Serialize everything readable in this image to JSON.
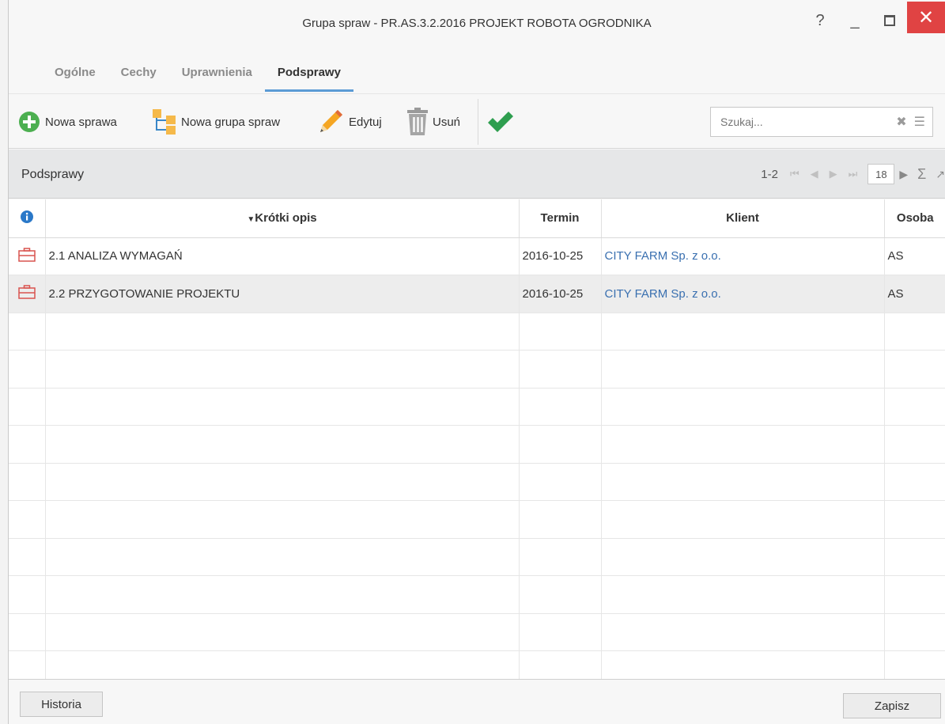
{
  "window": {
    "title": "Grupa spraw - PR.AS.3.2.2016 PROJEKT ROBOTA OGRODNIKA",
    "help_glyph": "?",
    "minimize_glyph": "_",
    "maximize_glyph": "□",
    "close_glyph": "✕"
  },
  "tabs": [
    {
      "label": "Ogólne"
    },
    {
      "label": "Cechy"
    },
    {
      "label": "Uprawnienia"
    },
    {
      "label": "Podsprawy"
    }
  ],
  "toolbar": {
    "new_case": "Nowa sprawa",
    "new_group": "Nowa grupa spraw",
    "edit": "Edytuj",
    "delete": "Usuń",
    "search_placeholder": "Szukaj..."
  },
  "panel": {
    "title": "Podsprawy",
    "range": "1-2",
    "page_size": "18"
  },
  "columns": {
    "description": "Krótki opis",
    "term": "Termin",
    "client": "Klient",
    "person": "Osoba"
  },
  "rows": [
    {
      "description": "2.1 ANALIZA WYMAGAŃ",
      "term": "2016-10-25",
      "client": "CITY FARM Sp. z o.o.",
      "person": "AS"
    },
    {
      "description": "2.2 PRZYGOTOWANIE PROJEKTU",
      "term": "2016-10-25",
      "client": "CITY FARM Sp. z o.o.",
      "person": "AS"
    }
  ],
  "footer": {
    "history": "Historia",
    "save": "Zapisz"
  },
  "colors": {
    "accent": "#5b9bd5",
    "link": "#3a70b0",
    "close": "#e04343",
    "add_icon": "#4caf50",
    "check_icon": "#2e9e4f"
  }
}
